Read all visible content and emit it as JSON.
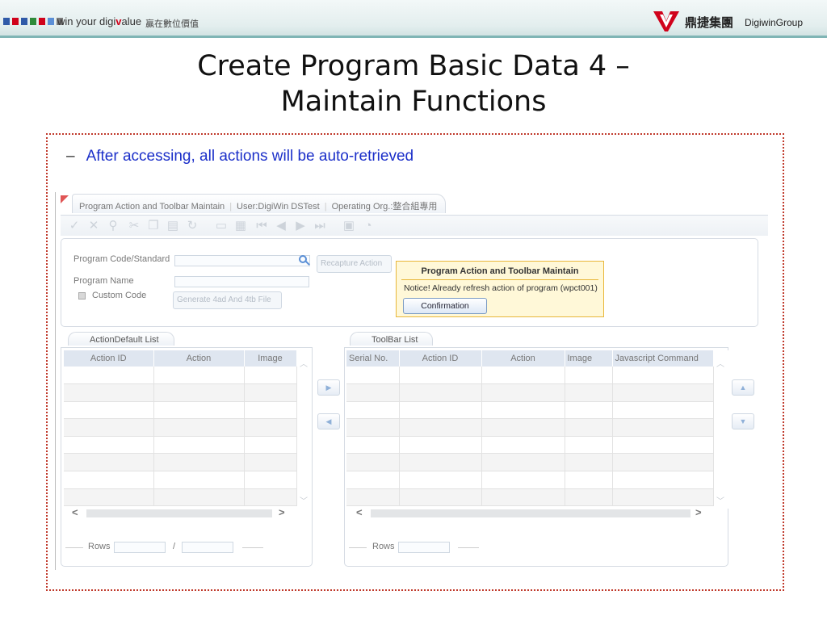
{
  "header": {
    "tagline_pre": "win your digi",
    "tagline_v": "v",
    "tagline_post": "alue",
    "tagline_cn": "贏在數位價值",
    "brand_cn": "鼎捷集團",
    "brand_en": "DigiwinGroup",
    "square_colors": [
      "#2f5aa8",
      "#d0021b",
      "#2f5aa8",
      "#2f8a3a",
      "#d0021b",
      "#5b8fd6",
      "#7a7a7a"
    ]
  },
  "slide": {
    "title_line1": "Create Program Basic Data 4 –",
    "title_line2": "Maintain Functions",
    "bullet_dash": "–",
    "bullet_text": "After accessing, all actions will be auto-retrieved"
  },
  "app": {
    "tab_title": "Program Action and Toolbar Maintain",
    "tab_user": "User:DigiWin DSTest",
    "tab_org": "Operating Org.:整合組專用",
    "toolbar_icons": [
      "check-icon",
      "close-icon",
      "search-icon",
      "cut-icon",
      "copy-icon",
      "paste-icon",
      "refresh-icon",
      "new-icon",
      "grid-icon",
      "first-icon",
      "prev-icon",
      "next-icon",
      "last-icon",
      "export-icon",
      "exit-icon"
    ],
    "form": {
      "program_code_label": "Program Code/Standard",
      "program_name_label": "Program Name",
      "custom_code_label": "Custom Code",
      "recapture_button": "Recapture Action",
      "generate_button": "Generate 4ad And 4tb File"
    },
    "dialog": {
      "title": "Program Action and Toolbar Maintain",
      "message": "Notice! Already refresh action of program (wpct001)",
      "button": "Confirmation"
    },
    "action_list": {
      "tab": "ActionDefault List",
      "columns": [
        "Action ID",
        "Action",
        "Image"
      ],
      "rows_label": "Rows",
      "rows_sep": "/"
    },
    "toolbar_list": {
      "tab": "ToolBar List",
      "columns": [
        "Serial No.",
        "Action ID",
        "Action",
        "Image",
        "Javascript Command"
      ],
      "rows_label": "Rows"
    }
  }
}
